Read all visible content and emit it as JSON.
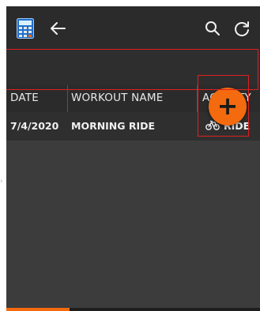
{
  "toolbar": {
    "app_icon": "calculator-icon",
    "back_icon": "arrow-left-icon",
    "search_icon": "search-icon",
    "refresh_icon": "refresh-icon"
  },
  "table": {
    "columns": [
      "DATE",
      "WORKOUT NAME",
      "ACTIVITY"
    ],
    "rows": [
      {
        "date": "7/4/2020",
        "workout_name": "MORNING RIDE",
        "activity": "RIDE",
        "activity_icon": "bicycle-icon"
      }
    ]
  },
  "fab": {
    "label": "+",
    "icon": "plus-icon"
  },
  "colors": {
    "accent": "#f46a0e",
    "background": "#3c3c3c",
    "toolbar": "#2b2b2b",
    "highlight": "#e02020"
  }
}
